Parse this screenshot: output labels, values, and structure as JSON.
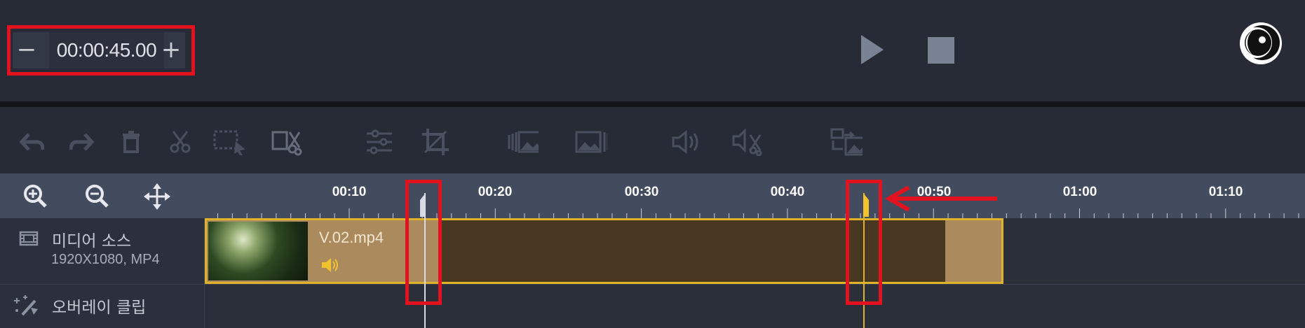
{
  "playback": {
    "time": "00:00:45.00",
    "minus": "−",
    "plus": "+"
  },
  "ruler": {
    "ticks": [
      "00:10",
      "00:20",
      "00:30",
      "00:40",
      "00:50",
      "01:00",
      "01:10"
    ]
  },
  "tracks": {
    "media_source": {
      "label": "미디어 소스",
      "info": "1920X1080, MP4"
    },
    "overlay": {
      "label": "오버레이 클립"
    }
  },
  "clip": {
    "name": "V.02.mp4"
  },
  "colors": {
    "highlight": "#e3121f",
    "clip_border": "#e0b22a",
    "clip_fill": "#ab8a5e",
    "clip_trimmed": "#483822"
  }
}
